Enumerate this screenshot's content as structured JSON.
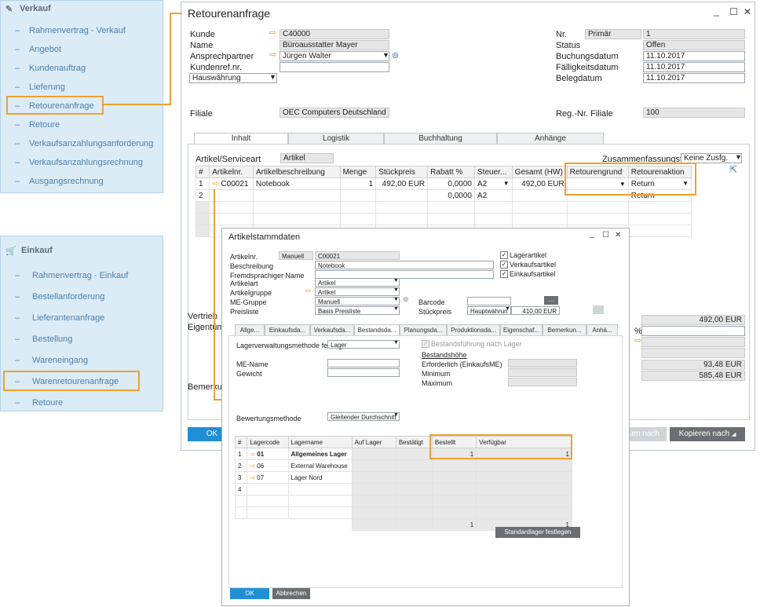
{
  "sidebar_verkauf": {
    "title": "Verkauf",
    "items": [
      "Rahmenvertrag - Verkauf",
      "Angebot",
      "Kundenauftrag",
      "Lieferung",
      "Retourenanfrage",
      "Retoure",
      "Verkaufsanzahlungsanforderung",
      "Verkaufsanzahlungsrechnung",
      "Ausgangsrechnung"
    ]
  },
  "sidebar_einkauf": {
    "title": "Einkauf",
    "items": [
      "Rahmenvertrag - Einkauf",
      "Bestellanforderung",
      "Lieferantenanfrage",
      "Bestellung",
      "Wareneingang",
      "Warenretourenanfrage",
      "Retoure"
    ]
  },
  "main": {
    "title": "Retourenanfrage",
    "kunde_label": "Kunde",
    "kunde_value": "C40000",
    "name_label": "Name",
    "name_value": "Büroausstatter Mayer",
    "ansprech_label": "Ansprechpartner",
    "ansprech_value": "Jürgen Walter",
    "kundenref_label": "Kundenref.nr.",
    "waehrung_value": "Hauswährung",
    "filiale_label": "Filiale",
    "filiale_value": "OEC Computers Deutschland",
    "nr_label": "Nr.",
    "nr_series": "Primär",
    "nr_value": "1",
    "status_label": "Status",
    "status_value": "Offen",
    "buchungsdatum_label": "Buchungsdatum",
    "buchungsdatum_value": "11.10.2017",
    "faelligkeit_label": "Fälligkeitsdatum",
    "faelligkeit_value": "11.10.2017",
    "belegdatum_label": "Belegdatum",
    "belegdatum_value": "11.10.2017",
    "regnr_label": "Reg.-Nr. Filiale",
    "regnr_value": "100",
    "tabs": [
      "Inhalt",
      "Logistik",
      "Buchhaltung",
      "Anhänge"
    ],
    "artikel_label": "Artikel/Serviceart",
    "artikel_value": "Artikel",
    "zus_label": "Zusammenfassungstyp",
    "zus_value": "Keine Zusfg.",
    "columns": [
      "#",
      "Artikelnr.",
      "Artikelbeschreibung",
      "Menge",
      "Stückpreis",
      "Rabatt %",
      "Steuer...",
      "Gesamt (HW)",
      "Retourengrund",
      "Retourenaktion"
    ],
    "rows": [
      [
        "1",
        "C00021",
        "Notebook",
        "1",
        "492,00 EUR",
        "0,0000",
        "A2",
        "492,00 EUR",
        "",
        "Return"
      ],
      [
        "2",
        "",
        "",
        "",
        "",
        "0,0000",
        "A2",
        "",
        "",
        "Return"
      ]
    ],
    "vertrieb_label": "Vertrieb",
    "eigentum_label": "Eigentüm",
    "bemerk_label": "Bemerkun",
    "total1": "492,00 EUR",
    "pct": "%",
    "total2": "93,48 EUR",
    "total3": "585,48 EUR",
    "ok_label": "OK",
    "gen_label": "...en nach",
    "copy_label": "Kopieren nach"
  },
  "popup": {
    "title": "Artikelstammdaten",
    "artikelnr_label": "Artikelnr.",
    "artikelnr_series": "Manuell",
    "artikelnr_value": "C00021",
    "beschreibung_label": "Beschreibung",
    "beschreibung_value": "Notebook",
    "fremd_label": "Fremdsprachiger Name",
    "artikelart_label": "Artikelart",
    "artikelart_value": "Artikel",
    "artikelgruppe_label": "Artikelgruppe",
    "artikelgruppe_value": "Artikel",
    "me_label": "ME-Gruppe",
    "me_value": "Manuell",
    "preisliste_label": "Preisliste",
    "preisliste_value": "Basis Preisliste",
    "barcode_label": "Barcode",
    "stueckpreis_label": "Stückpreis",
    "stueckpreis_curr": "Hauptwährun",
    "stueckpreis_value": "410,00 EUR",
    "lagerartikel": "Lagerartikel",
    "verkaufsartikel": "Verkaufsartikel",
    "einkaufsartikel": "Einkaufsartikel",
    "tabs": [
      "Allge...",
      "Einkaufsda...",
      "Verkaufsda...",
      "Bestandsda...",
      "Planungsda...",
      "Produktionsda...",
      "Eigenschaf...",
      "Bemerkun...",
      "Anhä..."
    ],
    "lagerverw_label": "Lagerverwaltungsmethode festlegen",
    "lagerverw_value": "Lager",
    "bestandsfuehrung": "Bestandsführung nach Lager",
    "bestandshoehe": "Bestandshöhe",
    "erforderlich_label": "Erforderlich (EinkaufsME)",
    "minimum_label": "Minimum",
    "maximum_label": "Maximum",
    "mename_label": "ME-Name",
    "gewicht_label": "Gewicht",
    "bewertung_label": "Bewertungsmethode",
    "bewertung_value": "Gleitender Durchschnitt",
    "columns": [
      "#",
      "Lagercode",
      "Lagername",
      "Auf Lager",
      "Bestätigt",
      "Bestellt",
      "Verfügbar"
    ],
    "rows": [
      [
        "1",
        "01",
        "Allgemeines Lager",
        "",
        "",
        "1",
        "1"
      ],
      [
        "2",
        "06",
        "External Warehouse",
        "",
        "",
        "",
        ""
      ],
      [
        "3",
        "07",
        "Lager Nord",
        "",
        "",
        "",
        ""
      ],
      [
        "4",
        "",
        "",
        "",
        "",
        "",
        ""
      ]
    ],
    "footer_bestellt": "1",
    "footer_verfuegbar": "1",
    "standard_btn": "Standardlager festlegen",
    "ok_label": "OK",
    "abbrechen_label": "Abbrechen"
  },
  "colors": {
    "highlight": "#f0a030",
    "ok_blue": "#1f8fd6",
    "sidebar_bg": "#dcecf7",
    "link": "#4a7fa8"
  }
}
